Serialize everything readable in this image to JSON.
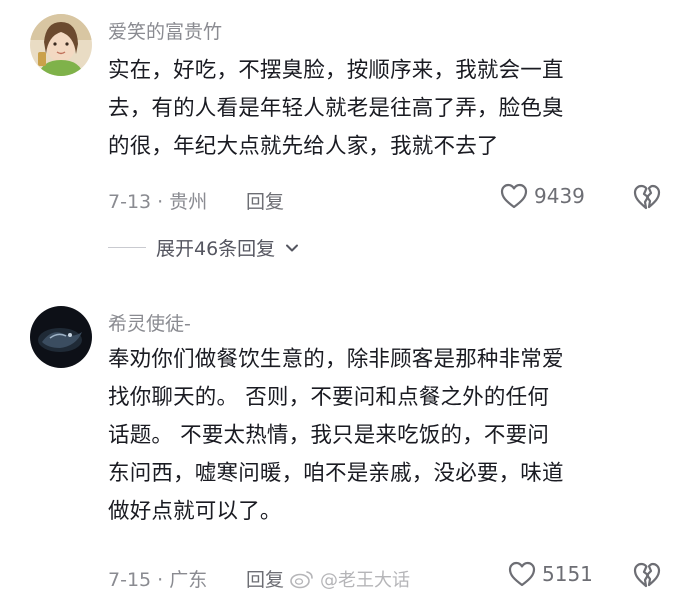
{
  "comments": [
    {
      "username": "爱笑的富贵竹",
      "text_lines": [
        "实在，好吃，不摆臭脸，按顺序来，我就会一直",
        "去，有的人看是年轻人就老是往高了弄，脸色臭",
        "的很，年纪大点就先给人家，我就不去了"
      ],
      "date_location": "7-13 · 贵州",
      "reply_label": "回复",
      "likes": "9439",
      "expand_label": "展开46条回复"
    },
    {
      "username": "希灵使徒-",
      "text_lines": [
        "奉劝你们做餐饮生意的，除非顾客是那种非常爱",
        "找你聊天的。 否则，不要问和点餐之外的任何",
        "话题。  不要太热情，我只是来吃饭的，不要问",
        "东问西，嘘寒问暖，咱不是亲戚，没必要，味道",
        "做好点就可以了。"
      ],
      "date_location": "7-15 · 广东",
      "reply_label": "回复",
      "likes": "5151"
    }
  ],
  "watermark": "@老王大话",
  "icons": {
    "like": "heart-outline-icon",
    "dislike": "broken-heart-icon",
    "expand": "chevron-down-icon",
    "watermark": "weibo-logo-icon"
  },
  "colors": {
    "text": "#1a1b22",
    "meta": "#8a8b91",
    "icon": "#6d6e74"
  }
}
